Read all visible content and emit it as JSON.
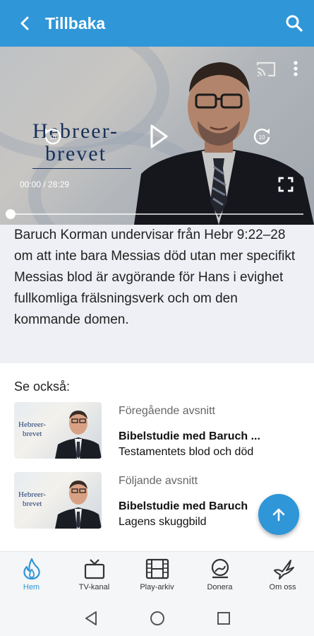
{
  "appbar": {
    "title": "Tillbaka"
  },
  "player": {
    "logo_line1": "Hebreer-",
    "logo_line2": "brevet",
    "time": "00:00 / 28:29",
    "progress": 0
  },
  "description": "Baruch Korman undervisar från Hebr 9:22–28 om att inte bara Messias död utan mer specifikt Messias blod är avgörande för Hans i evighet fullkomliga frälsningsverk och om den kommande domen.",
  "see_also": {
    "heading": "Se också:",
    "episodes": [
      {
        "kind": "Föregående avsnitt",
        "title": "Bibelstudie med Baruch ...",
        "subtitle": "Testamentets blod och död",
        "thumb_line1": "Hebreer-",
        "thumb_line2": "brevet"
      },
      {
        "kind": "Följande avsnitt",
        "title": "Bibelstudie med Baruch",
        "subtitle": "Lagens skuggbild",
        "thumb_line1": "Hebreer-",
        "thumb_line2": "brevet"
      }
    ]
  },
  "bottom_nav": [
    {
      "label": "Hem",
      "icon": "flame-icon",
      "active": true
    },
    {
      "label": "TV-kanal",
      "icon": "tv-icon",
      "active": false
    },
    {
      "label": "Play-arkiv",
      "icon": "film-icon",
      "active": false
    },
    {
      "label": "Donera",
      "icon": "donate-icon",
      "active": false
    },
    {
      "label": "Om oss",
      "icon": "dove-icon",
      "active": false
    }
  ],
  "colors": {
    "accent": "#2f96d8",
    "logo": "#1f3b6e"
  }
}
